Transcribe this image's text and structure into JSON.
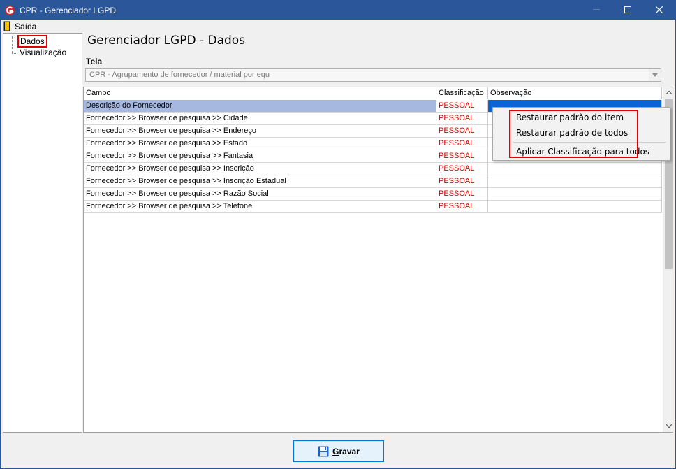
{
  "window": {
    "title": "CPR - Gerenciador LGPD",
    "title_bar_color": "#2b579a"
  },
  "menu": {
    "exit_label": "Saída"
  },
  "tree": {
    "items": [
      {
        "label": "Dados",
        "selected": true
      },
      {
        "label": "Visualização",
        "selected": false
      }
    ]
  },
  "page": {
    "title": "Gerenciador LGPD - Dados",
    "tela_label": "Tela",
    "tela_value": "CPR - Agrupamento de fornecedor / material por equ"
  },
  "grid": {
    "headers": {
      "campo": "Campo",
      "classificacao": "Classificação",
      "observacao": "Observação"
    },
    "rows": [
      {
        "campo": "Descrição do Fornecedor",
        "classificacao": "PESSOAL",
        "observacao": ""
      },
      {
        "campo": "Fornecedor >> Browser de pesquisa >> Cidade",
        "classificacao": "PESSOAL",
        "observacao": ""
      },
      {
        "campo": "Fornecedor >> Browser de pesquisa >> Endereço",
        "classificacao": "PESSOAL",
        "observacao": ""
      },
      {
        "campo": "Fornecedor >> Browser de pesquisa >> Estado",
        "classificacao": "PESSOAL",
        "observacao": ""
      },
      {
        "campo": "Fornecedor >> Browser de pesquisa >> Fantasia",
        "classificacao": "PESSOAL",
        "observacao": ""
      },
      {
        "campo": "Fornecedor >> Browser de pesquisa >> Inscrição",
        "classificacao": "PESSOAL",
        "observacao": ""
      },
      {
        "campo": "Fornecedor >> Browser de pesquisa >> Inscrição Estadual",
        "classificacao": "PESSOAL",
        "observacao": ""
      },
      {
        "campo": "Fornecedor >> Browser de pesquisa >> Razão Social",
        "classificacao": "PESSOAL",
        "observacao": ""
      },
      {
        "campo": "Fornecedor >> Browser de pesquisa >> Telefone",
        "classificacao": "PESSOAL",
        "observacao": ""
      }
    ],
    "selected_row": 0,
    "classification_color": "#d40000"
  },
  "context_menu": {
    "items": [
      "Restaurar padrão do item",
      "Restaurar padrão de todos",
      "Aplicar Classificação para todos"
    ]
  },
  "footer": {
    "save_label_underlined": "G",
    "save_label_rest": "ravar"
  },
  "icons": {
    "app": "app-logo-icon",
    "exit": "exit-door-icon",
    "save": "floppy-disk-icon"
  },
  "highlight_color": "#e00000"
}
